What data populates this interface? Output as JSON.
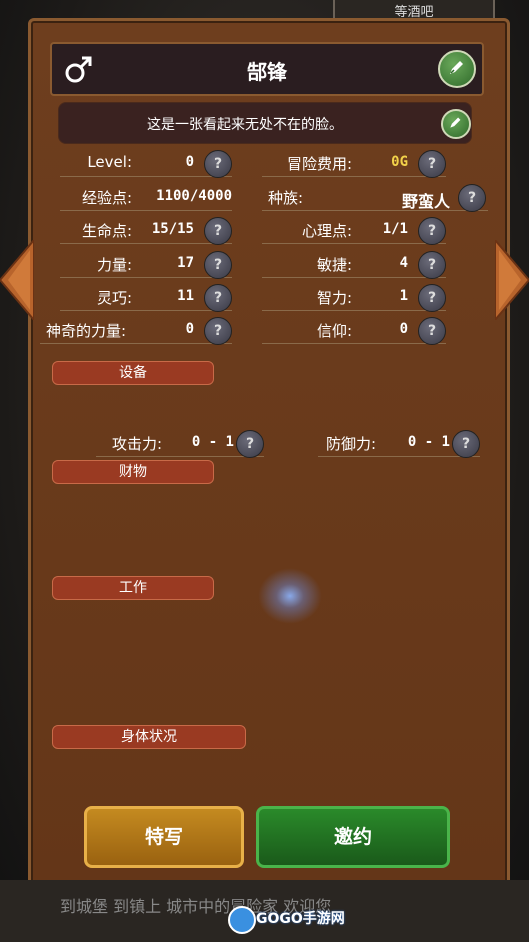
{
  "top_tab": {
    "label": "等酒吧"
  },
  "header": {
    "name": "郜锋",
    "gender_icon": "male-symbol-icon"
  },
  "description": {
    "text": "这是一张看起来无处不在的脸。"
  },
  "stats_left": [
    {
      "label": "Level:",
      "value": "0"
    },
    {
      "label": "经验点:",
      "value": "1100/4000"
    },
    {
      "label": "生命点:",
      "value": "15/15"
    },
    {
      "label": "力量:",
      "value": "17"
    },
    {
      "label": "灵巧:",
      "value": "11"
    },
    {
      "label": "神奇的力量:",
      "value": "0"
    }
  ],
  "stats_right": [
    {
      "label": "冒险费用:",
      "value": "0G"
    },
    {
      "label": "种族:",
      "value": "野蛮人"
    },
    {
      "label": "心理点:",
      "value": "1/1"
    },
    {
      "label": "敏捷:",
      "value": "4"
    },
    {
      "label": "智力:",
      "value": "1"
    },
    {
      "label": "信仰:",
      "value": "0"
    }
  ],
  "sections": {
    "equipment": "设备",
    "attack_label": "攻击力:",
    "attack_value": "0 - 1",
    "defense_label": "防御力:",
    "defense_value": "0 - 1",
    "property": "财物",
    "work": "工作",
    "condition": "身体状况"
  },
  "question_mark": "?",
  "buttons": {
    "closeup": "特写",
    "invite": "邀约"
  },
  "bottom": {
    "text": "到城堡     到镇上     城市中的冒险家  欢迎您"
  },
  "watermark": {
    "text": "GOGO手游网"
  },
  "colors": {
    "panel": "#6a3b1c",
    "gold_value": "#f2d24a",
    "invite_green": "#2a8a2a",
    "closeup_gold": "#c48a20"
  }
}
